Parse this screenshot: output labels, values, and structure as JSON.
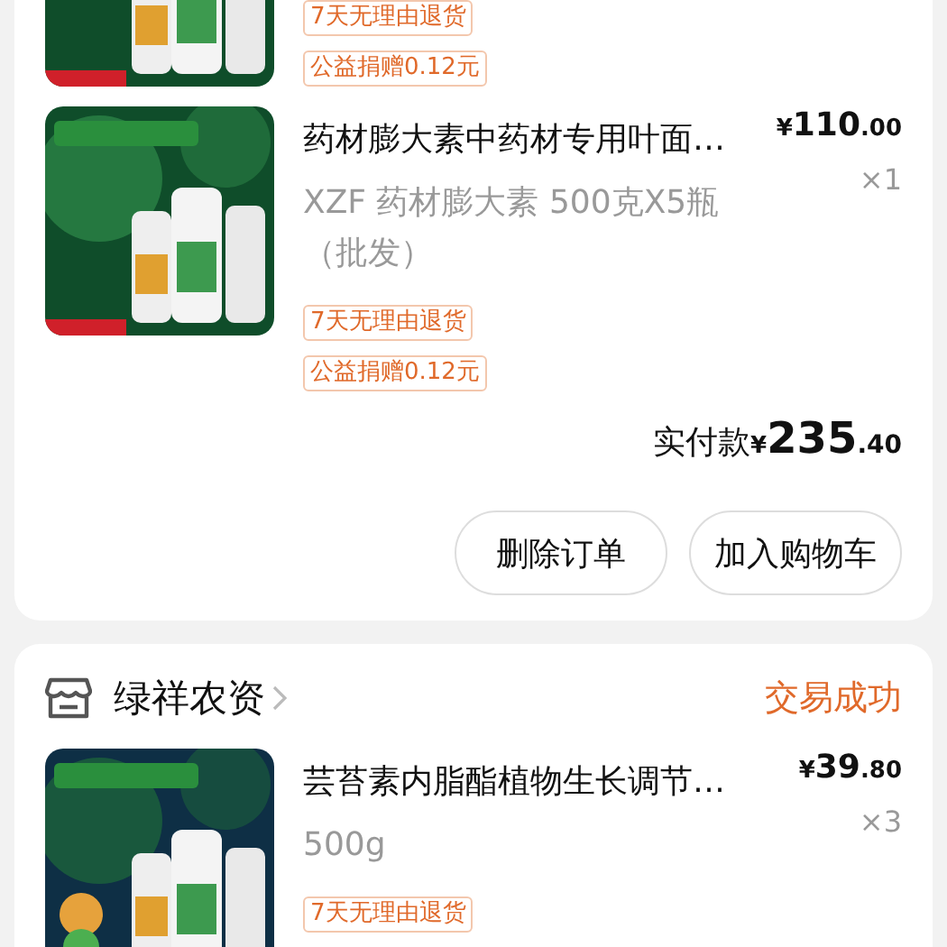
{
  "orders": [
    {
      "items": [
        {
          "picture": {
            "kind": "picture"
          },
          "tags": [
            "7天无理由退货",
            "公益捐赠0.12元"
          ]
        },
        {
          "picture": {
            "kind": "picture"
          },
          "title": "药材膨大素中药材专用叶面…",
          "spec": "XZF 药材膨大素 500克X5瓶（批发）",
          "price": {
            "currency": "¥",
            "integer": "110",
            "decimal": ".00"
          },
          "quantity": "×1",
          "tags": [
            "7天无理由退货",
            "公益捐赠0.12元"
          ]
        }
      ],
      "total": {
        "label": "实付款",
        "currency": "¥",
        "integer": "235",
        "decimal": ".40"
      },
      "buttons": [
        "删除订单",
        "加入购物车"
      ]
    },
    {
      "shop": {
        "name": "绿祥农资"
      },
      "status": "交易成功",
      "items": [
        {
          "picture": {
            "kind": "picture"
          },
          "title": "芸苔素内脂酯植物生长调节…",
          "spec": "500g",
          "price": {
            "currency": "¥",
            "integer": "39",
            "decimal": ".80"
          },
          "quantity": "×3",
          "tags": [
            "7天无理由退货"
          ]
        }
      ]
    }
  ]
}
